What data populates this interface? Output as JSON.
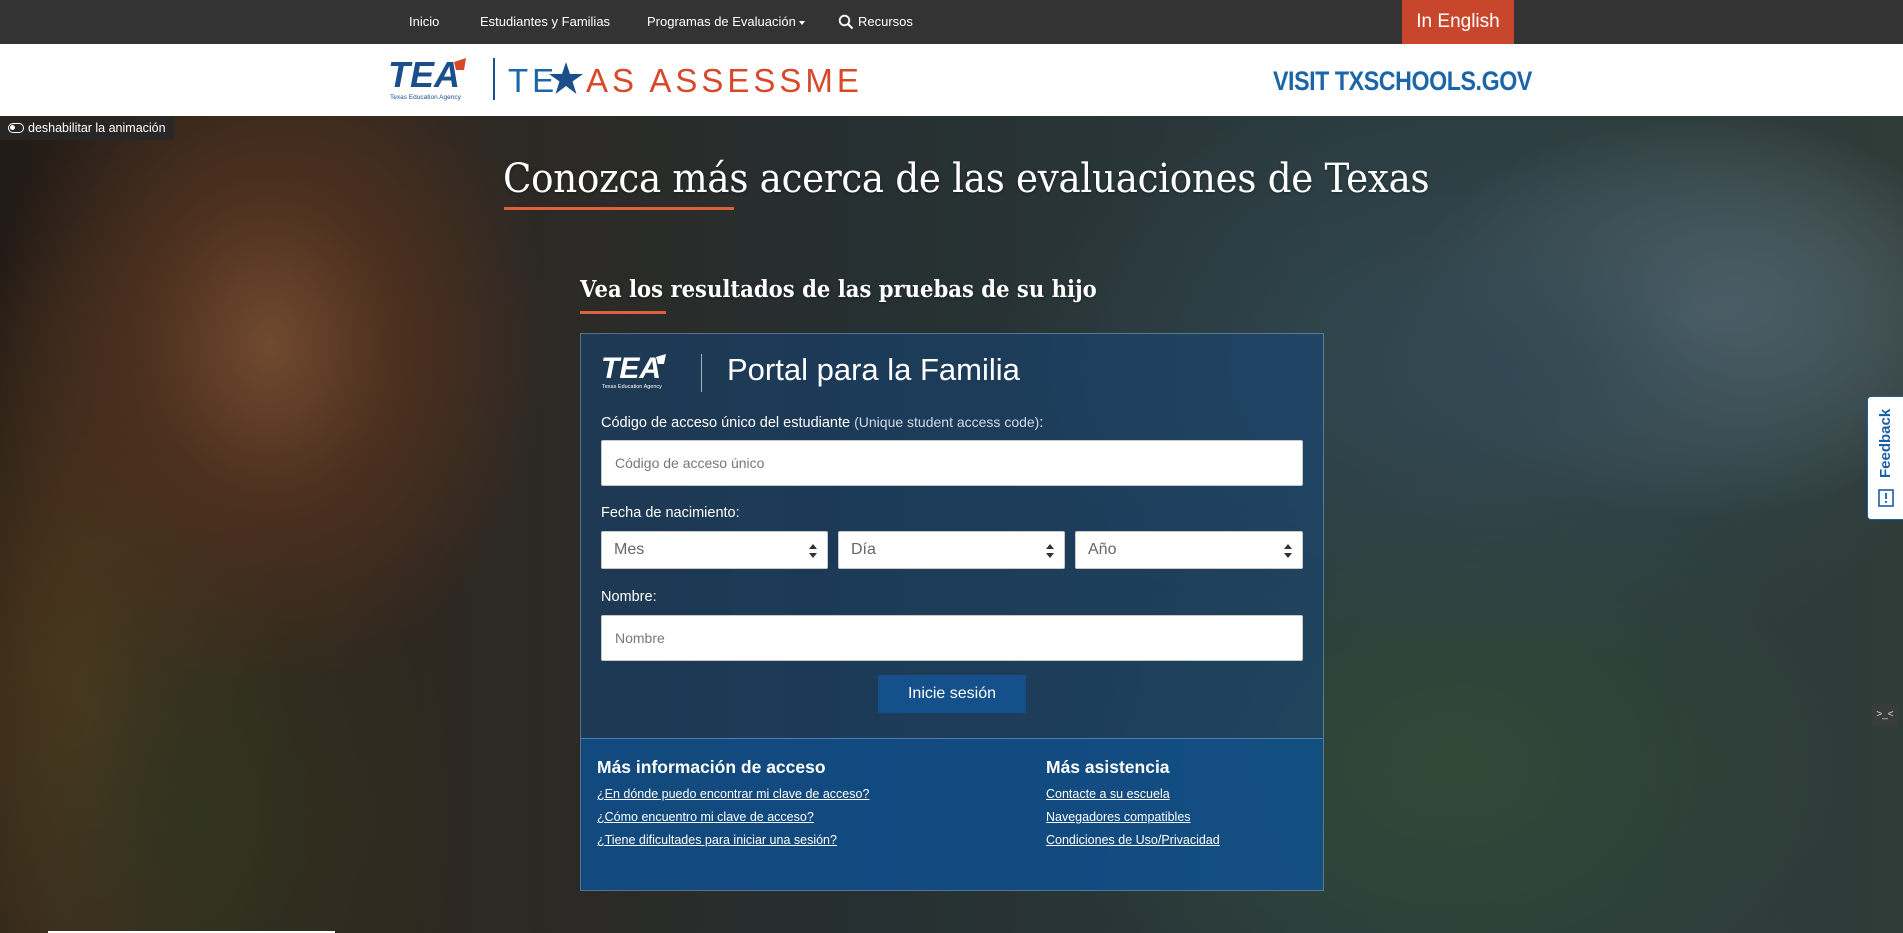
{
  "topnav": {
    "items": [
      {
        "label": "Inicio"
      },
      {
        "label": "Estudiantes y Familias"
      },
      {
        "label": "Programas de Evaluación"
      },
      {
        "label": "Recursos"
      }
    ],
    "english_button": "In English"
  },
  "logobar": {
    "tea_logo_text": "TEA",
    "tea_logo_sub": "Texas Education Agency",
    "texas_assessment_left": "TE",
    "texas_assessment_right": "AS ASSESSMENT",
    "visit_link": "VISIT TXSCHOOLS.GOV"
  },
  "hero": {
    "animation_toggle": "deshabilitar la animación",
    "title": "Conozca más acerca de las evaluaciones de Texas",
    "subtitle": "Vea los resultados de las pruebas de su hijo"
  },
  "portal": {
    "logo_text": "TEA",
    "logo_sub": "Texas Education Agency",
    "title": "Portal para la Familia",
    "access_code_label": "Código de acceso único del estudiante",
    "access_code_hint": "(Unique student access code)",
    "access_code_colon": ":",
    "access_code_placeholder": "Código de acceso único",
    "dob_label": "Fecha de nacimiento:",
    "month_select": "Mes",
    "day_select": "Día",
    "year_select": "Año",
    "name_label": "Nombre:",
    "name_placeholder": "Nombre",
    "login_button": "Inicie sesión"
  },
  "info": {
    "access_heading": "Más información de acceso",
    "access_links": [
      "¿En dónde puedo encontrar mi clave de acceso?",
      "¿Cómo encuentro mi clave de acceso?",
      "¿Tiene dificultades para iniciar una sesión?"
    ],
    "help_heading": "Más asistencia",
    "help_links": [
      "Contacte a su escuela",
      "Navegadores compatibles",
      "Condiciones de Uso/Privacidad"
    ]
  },
  "feedback": {
    "label": "Feedback"
  },
  "colors": {
    "nav_bg": "#333333",
    "english_btn": "#c8472c",
    "accent_orange": "#e0603c",
    "brand_blue": "#1b66a8",
    "login_btn": "#14508a"
  }
}
